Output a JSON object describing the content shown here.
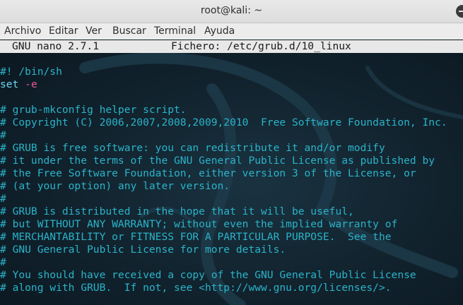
{
  "window": {
    "title": "root@kali: ~"
  },
  "menubar": {
    "items": [
      "Archivo",
      "Editar",
      "Ver",
      "Buscar",
      "Terminal",
      "Ayuda"
    ]
  },
  "nano": {
    "version": "GNU nano 2.7.1",
    "file_label": "Fichero: /etc/grub.d/10_linux"
  },
  "colors": {
    "comment": "#2bb3c9",
    "keyword": "#6fd7f0",
    "flag": "#e65b9b",
    "background": "#12242f"
  },
  "code": {
    "shebang": "#! /bin/sh",
    "set_keyword": "set",
    "set_flag": "-e",
    "comments": [
      "# grub-mkconfig helper script.",
      "# Copyright (C) 2006,2007,2008,2009,2010  Free Software Foundation, Inc.",
      "#",
      "# GRUB is free software: you can redistribute it and/or modify",
      "# it under the terms of the GNU General Public License as published by",
      "# the Free Software Foundation, either version 3 of the License, or",
      "# (at your option) any later version.",
      "#",
      "# GRUB is distributed in the hope that it will be useful,",
      "# but WITHOUT ANY WARRANTY; without even the implied warranty of",
      "# MERCHANTABILITY or FITNESS FOR A PARTICULAR PURPOSE.  See the",
      "# GNU General Public License for more details.",
      "#",
      "# You should have received a copy of the GNU General Public License",
      "# along with GRUB.  If not, see <http://www.gnu.org/licenses/>."
    ]
  }
}
